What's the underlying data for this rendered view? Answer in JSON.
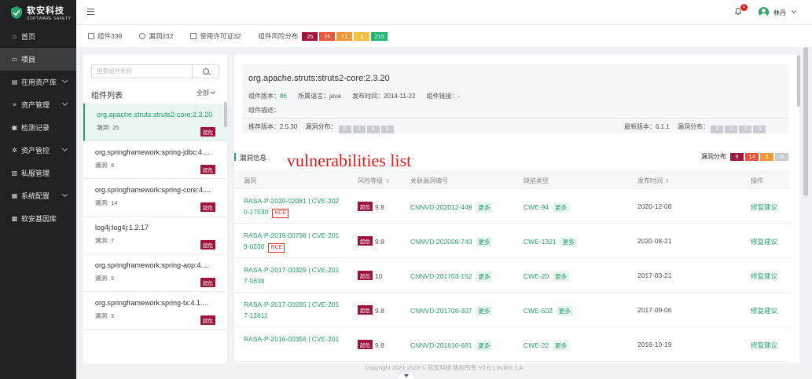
{
  "brand": {
    "name": "软安科技",
    "subtitle": "SOFTWARE SAFETY"
  },
  "nav": [
    {
      "label": "首页",
      "icon": "home-icon",
      "active": false,
      "chevron": false
    },
    {
      "label": "项目",
      "icon": "folder-icon",
      "active": true,
      "chevron": false
    },
    {
      "label": "在用资产库",
      "icon": "database-icon",
      "active": false,
      "chevron": true
    },
    {
      "label": "资产管理",
      "icon": "list-icon",
      "active": false,
      "chevron": true
    },
    {
      "label": "检测记录",
      "icon": "record-icon",
      "active": false,
      "chevron": false
    },
    {
      "label": "资产管控",
      "icon": "gear-icon",
      "active": false,
      "chevron": true
    },
    {
      "label": "私服管理",
      "icon": "server-icon",
      "active": false,
      "chevron": false
    },
    {
      "label": "系统配置",
      "icon": "config-icon",
      "active": false,
      "chevron": true
    },
    {
      "label": "软安基因库",
      "icon": "grid-icon",
      "active": false,
      "chevron": false
    }
  ],
  "topbar": {
    "notification_count": "1",
    "username": "林丹"
  },
  "stats": {
    "components": "组件339",
    "vulns": "漏洞232",
    "licenses": "使用许可证32",
    "risk_label": "组件风险分布",
    "risk_pills": [
      {
        "value": "25",
        "color": "#a0153e"
      },
      {
        "value": "25",
        "color": "#e8543c"
      },
      {
        "value": "71",
        "color": "#f0983a"
      },
      {
        "value": "3",
        "color": "#f5c242"
      },
      {
        "value": "215",
        "color": "#22b573"
      }
    ]
  },
  "component_list": {
    "search_placeholder": "搜索组件名称",
    "title": "组件列表",
    "filter": "全部",
    "items": [
      {
        "name": "org.apache.struts:struts2-core:2.3.20",
        "vuln_label": "漏洞:",
        "vuln_count": "25",
        "tag": "超危",
        "selected": true
      },
      {
        "name": "org.springframework:spring-jdbc:4....",
        "vuln_label": "漏洞:",
        "vuln_count": "6",
        "tag": "超危",
        "selected": false
      },
      {
        "name": "org.springframework:spring-core:4....",
        "vuln_label": "漏洞:",
        "vuln_count": "14",
        "tag": "超危",
        "selected": false
      },
      {
        "name": "log4j:log4j:1.2.17",
        "vuln_label": "漏洞:",
        "vuln_count": "7",
        "tag": "超危",
        "selected": false
      },
      {
        "name": "org.springframework:spring-aop:4....",
        "vuln_label": "漏洞:",
        "vuln_count": "5",
        "tag": "超危",
        "selected": false
      },
      {
        "name": "org.springframework:spring-tx:4.1....",
        "vuln_label": "漏洞:",
        "vuln_count": "5",
        "tag": "超危",
        "selected": false
      }
    ]
  },
  "detail": {
    "title": "org.apache.struts:struts2-core:2.3.20",
    "version_label": "组件版本：",
    "version": "86",
    "lang_label": "所属语言：",
    "lang": "java",
    "date_label": "发布时间：",
    "date": "2014-11-22",
    "link_label": "组件链接：",
    "link": "-",
    "desc_label": "组件描述：",
    "recommend_label": "推荐版本：",
    "recommend": "2.5.30",
    "dist_label": "漏洞分布：",
    "latest_label": "最新版本：",
    "latest": "6.1.1",
    "dist_label2": "漏洞分布：",
    "zeros": [
      "0",
      "0",
      "0",
      "0"
    ]
  },
  "vuln_section": {
    "title": "漏洞信息",
    "overlay": "vulnerabilities list",
    "dist_label": "漏洞分布",
    "dist": [
      {
        "value": "9",
        "color": "#a0153e"
      },
      {
        "value": "14",
        "color": "#e8543c"
      },
      {
        "value": "2",
        "color": "#f0983a"
      },
      {
        "value": "0",
        "color": "#c9cdd2"
      }
    ]
  },
  "table": {
    "headers": {
      "vuln": "漏洞",
      "risk": "风险等级",
      "related": "关联漏洞编号",
      "cwe": "缺陷类型",
      "published": "发布时间",
      "action": "操作"
    },
    "rows": [
      {
        "id_line1": "RASA-P-2020-02081 | CVE-202",
        "id_line2": "0-17530",
        "rce": "RCE",
        "level": "超危",
        "score": "9.8",
        "cnnvd": "CNNVD-202012-449",
        "more1": "更多",
        "cwe": "CWE-94",
        "more2": "更多",
        "date": "2020-12-08",
        "action": "修复建议"
      },
      {
        "id_line1": "RASA-P-2019-00798 | CVE-201",
        "id_line2": "9-0230",
        "rce": "RCE",
        "level": "超危",
        "score": "9.8",
        "cnnvd": "CNNVD-202008-743",
        "more1": "更多",
        "cwe": "CWE-1321",
        "more2": "更多",
        "date": "2020-08-21",
        "action": "修复建议"
      },
      {
        "id_line1": "RASA-P-2017-00329 | CVE-201",
        "id_line2": "7-5638",
        "rce": "",
        "level": "超危",
        "score": "10",
        "cnnvd": "CNNVD-201703-152",
        "more1": "更多",
        "cwe": "CWE-20",
        "more2": "更多",
        "date": "2017-03-21",
        "action": "修复建议"
      },
      {
        "id_line1": "RASA-P-2017-00285 | CVE-201",
        "id_line2": "7-12611",
        "rce": "",
        "level": "超危",
        "score": "9.8",
        "cnnvd": "CNNVD-201708-307",
        "more1": "更多",
        "cwe": "CWE-502",
        "more2": "更多",
        "date": "2017-09-06",
        "action": "修复建议"
      },
      {
        "id_line1": "RASA-P-2016-00356 | CVE-201",
        "id_line2": "",
        "rce": "",
        "level": "超危",
        "score": "9.8",
        "cnnvd": "CNNVD-201610-681",
        "more1": "更多",
        "cwe": "CWE-22",
        "more2": "更多",
        "date": "2016-10-19",
        "action": "修复建议"
      }
    ]
  },
  "footer": "Copyright 2021-2023 © 软安科技 版权所有 V2.6.1.build1.1.A"
}
